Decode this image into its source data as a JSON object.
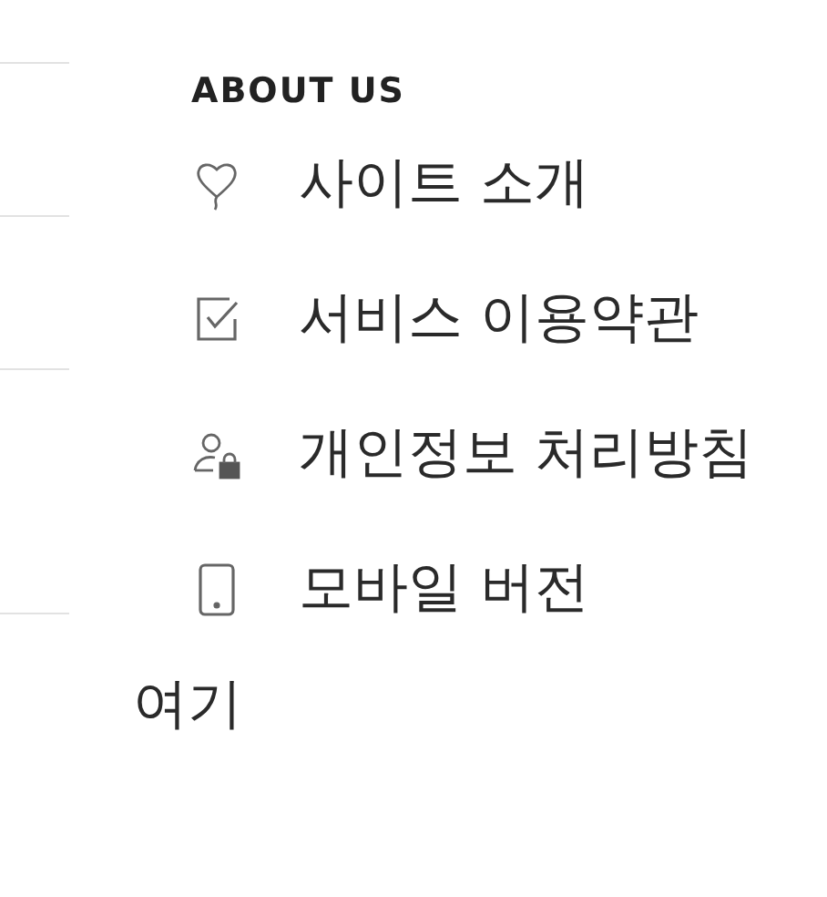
{
  "section": {
    "heading": "ABOUT US",
    "items": [
      {
        "label": "사이트 소개"
      },
      {
        "label": "서비스 이용약관"
      },
      {
        "label": "개인정보 처리방침"
      },
      {
        "label": "모바일 버전"
      }
    ]
  },
  "footer_text": "여기"
}
